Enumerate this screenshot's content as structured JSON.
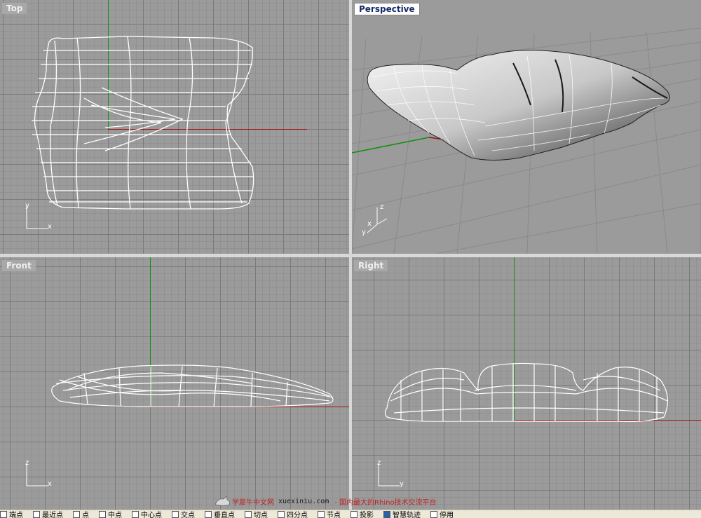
{
  "viewports": {
    "top": {
      "label": "Top",
      "axis_primary": "y",
      "axis_secondary": "x"
    },
    "perspective": {
      "label": "Perspective",
      "axis_primary": "z",
      "axis_secondary": "y",
      "axis_tertiary": "x"
    },
    "front": {
      "label": "Front",
      "axis_primary": "z",
      "axis_secondary": "x"
    },
    "right": {
      "label": "Right",
      "axis_primary": "z",
      "axis_secondary": "y"
    }
  },
  "colors": {
    "x_axis": "#a01010",
    "y_axis": "#109010",
    "wireframe": "#ffffff",
    "background": "#9b9b9b"
  },
  "osnap_bar": {
    "items": [
      {
        "label": "端点",
        "checked": false
      },
      {
        "label": "最近点",
        "checked": false
      },
      {
        "label": "点",
        "checked": false
      },
      {
        "label": "中点",
        "checked": false
      },
      {
        "label": "中心点",
        "checked": false
      },
      {
        "label": "交点",
        "checked": false
      },
      {
        "label": "垂直点",
        "checked": false
      },
      {
        "label": "切点",
        "checked": false
      },
      {
        "label": "四分点",
        "checked": false
      },
      {
        "label": "节点",
        "checked": false
      },
      {
        "label": "投影",
        "checked": false
      },
      {
        "label": "智慧轨迹",
        "checked": true
      },
      {
        "label": "停用",
        "checked": false
      }
    ]
  },
  "watermark": {
    "site": "学犀牛中文网",
    "domain": "xuexiniu.com",
    "slogan": "- 国内最大的Rhino技术交流平台"
  }
}
